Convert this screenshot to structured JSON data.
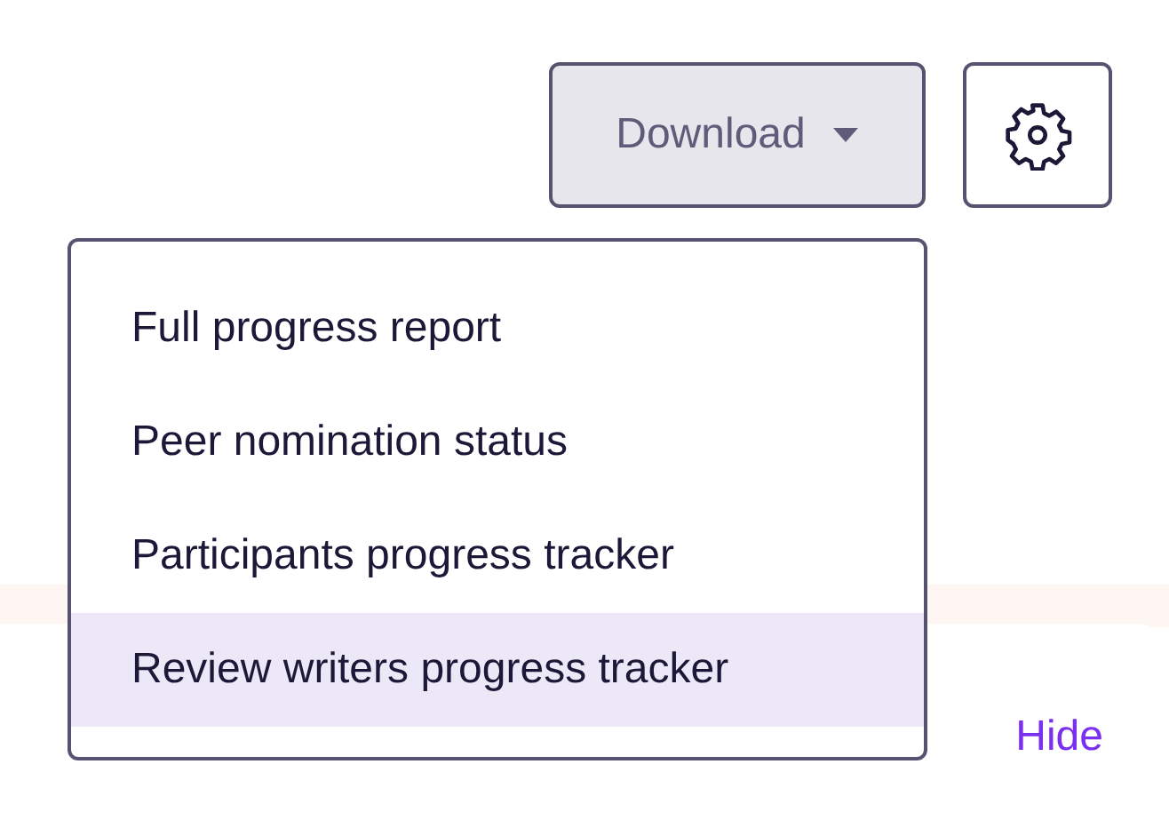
{
  "toolbar": {
    "download_button": {
      "label": "Download",
      "expanded": true
    }
  },
  "download_menu": {
    "items": [
      {
        "label": "Full progress report",
        "selected": false
      },
      {
        "label": "Peer nomination status",
        "selected": false
      },
      {
        "label": "Participants progress tracker",
        "selected": false
      },
      {
        "label": "Review writers progress tracker",
        "selected": true
      }
    ]
  },
  "hide_link": "Hide"
}
